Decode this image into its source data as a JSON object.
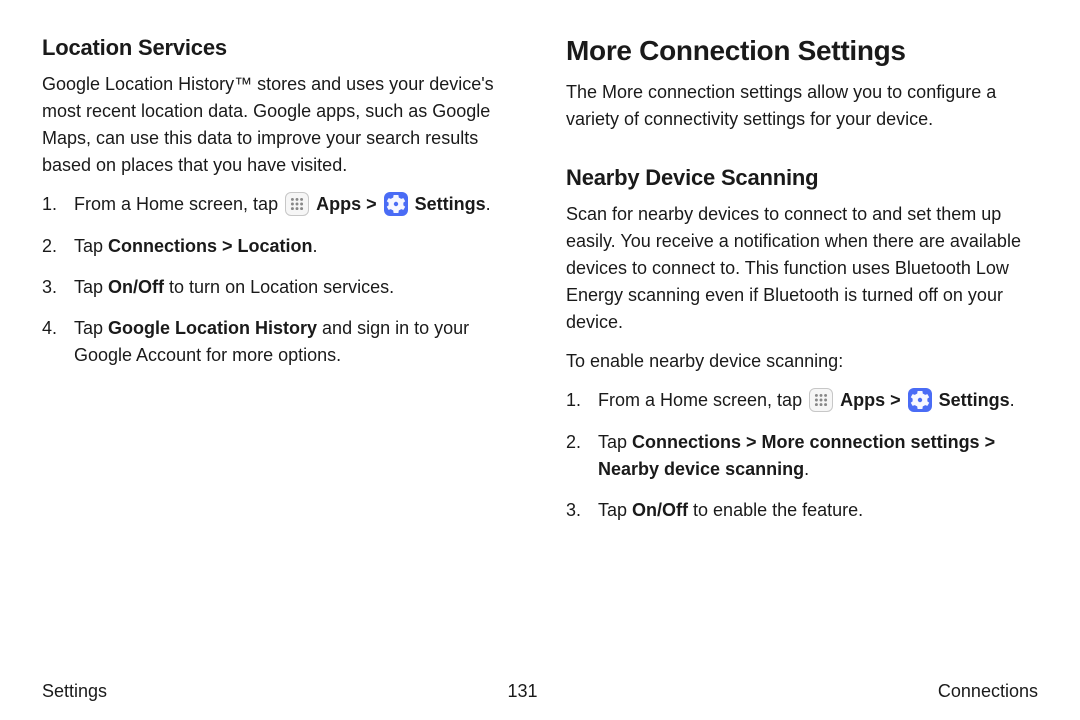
{
  "left": {
    "h2": "Location Services",
    "intro": "Google Location History™ stores and uses your device's most recent location data. Google apps, such as Google Maps, can use this data to improve your search results based on places that you have visited.",
    "step1_prefix": "From a Home screen, tap ",
    "apps_label": "Apps",
    "sep": " > ",
    "settings_label": "Settings",
    "period": ".",
    "step2_prefix": "Tap ",
    "step2_bold": "Connections > Location",
    "step3_prefix": "Tap ",
    "step3_bold": "On/Off",
    "step3_suffix": " to turn on Location services.",
    "step4_prefix": "Tap ",
    "step4_bold": "Google Location History",
    "step4_suffix": " and sign in to your Google Account for more options."
  },
  "right": {
    "h1": "More Connection Settings",
    "intro": "The More connection settings allow you to configure a variety of connectivity settings for your device.",
    "h2": "Nearby Device Scanning",
    "desc": "Scan for nearby devices to connect to and set them up easily. You receive a notification when there are available devices to connect to. This function uses Bluetooth Low Energy scanning even if Bluetooth is turned off on your device.",
    "enable": "To enable nearby device scanning:",
    "step1_prefix": "From a Home screen, tap ",
    "apps_label": "Apps",
    "sep": " > ",
    "settings_label": "Settings",
    "period": ".",
    "step2_prefix": "Tap ",
    "step2_bold": "Connections > More connection settings > Nearby device scanning",
    "step3_prefix": "Tap ",
    "step3_bold": "On/Off",
    "step3_suffix": " to enable the feature."
  },
  "footer": {
    "left": "Settings",
    "center": "131",
    "right": "Connections"
  }
}
